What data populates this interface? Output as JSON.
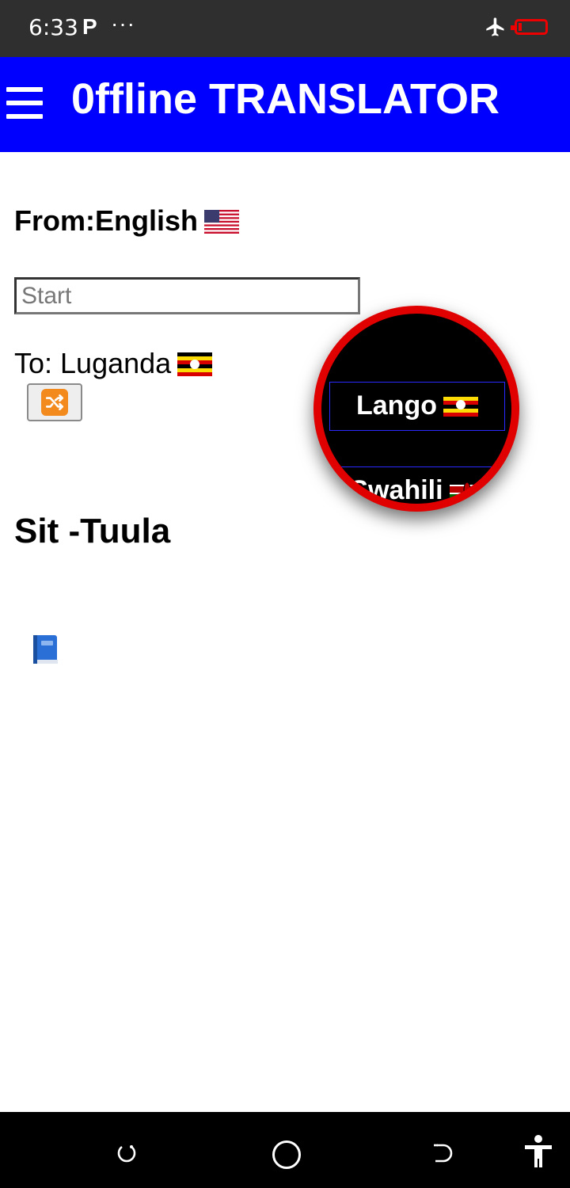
{
  "status_bar": {
    "time": "6:33",
    "app_indicator": "P",
    "more": "···",
    "icons": [
      "airplane-icon",
      "battery-icon"
    ],
    "battery_color": "#e00000"
  },
  "app_bar": {
    "title": "0ffline TRANSLATOR",
    "menu_icon": "hamburger-menu-icon",
    "background": "#0000ff"
  },
  "translator": {
    "from_label": "From:English",
    "from_flag": "us-flag-icon",
    "input_placeholder": "Start",
    "input_value": "",
    "to_label": "To: Luganda",
    "to_flag": "uganda-flag-icon",
    "swap_icon": "shuffle-icon",
    "result": "Sit -Tuula",
    "dictionary_icon": "blue-book-icon"
  },
  "language_magnifier": {
    "options": [
      {
        "label": "Lango",
        "flag": "uganda-flag-icon"
      },
      {
        "label": "Swahili",
        "flag": "kenya-flag-icon"
      }
    ],
    "ring_color": "#e00000"
  },
  "nav_bar": {
    "buttons": [
      "recents-icon",
      "home-icon",
      "back-icon",
      "accessibility-icon"
    ]
  }
}
